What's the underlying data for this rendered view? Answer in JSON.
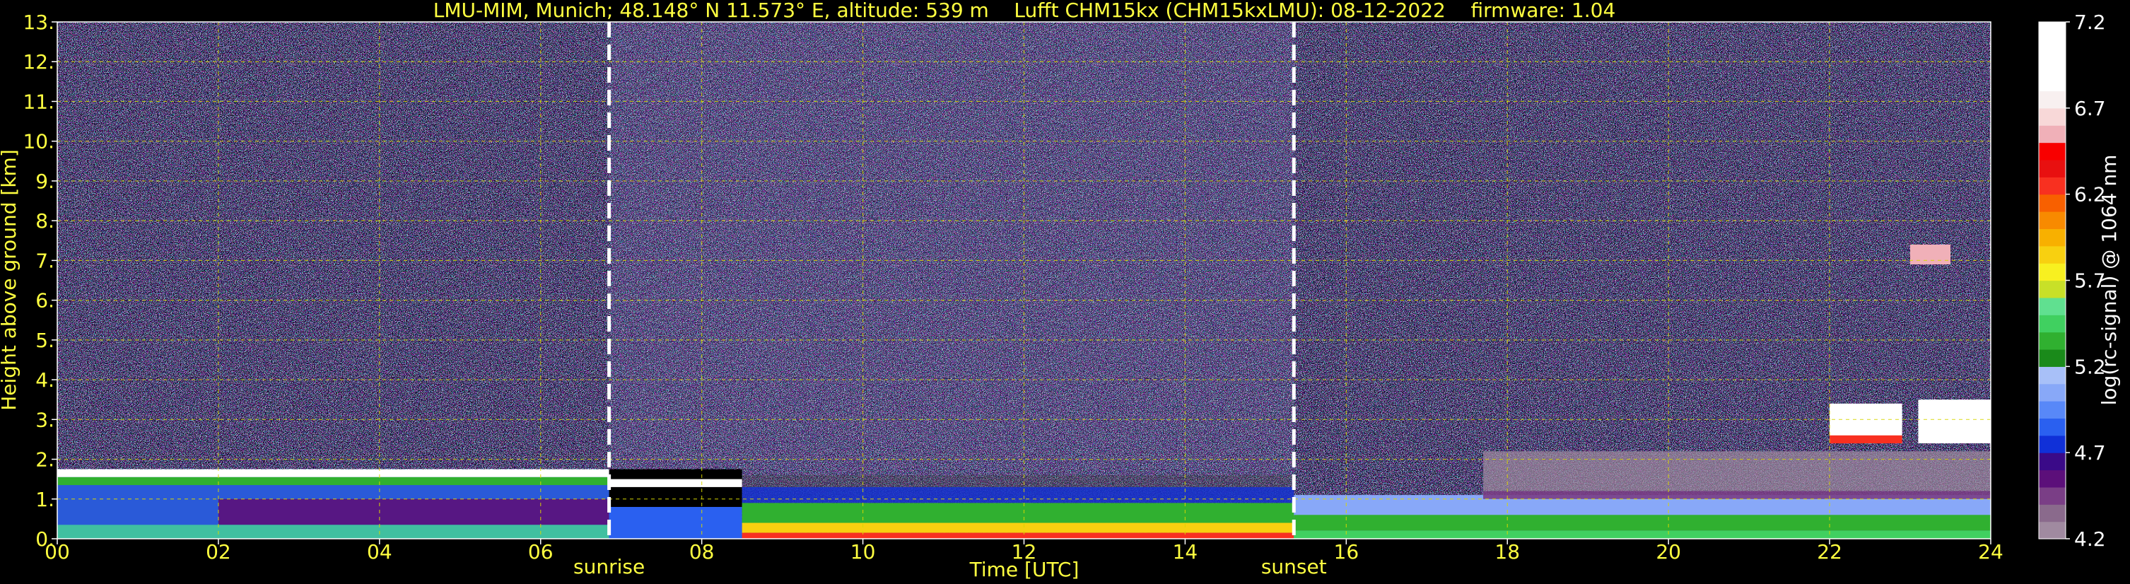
{
  "chart_data": {
    "type": "heatmap",
    "title": "LMU-MIM, Munich; 48.148° N 11.573° E, altitude: 539 m    Lufft CHM15kx (CHM15kxLMU): 08-12-2022    firmware: 1.04",
    "xlabel": "Time [UTC]",
    "ylabel": "Height above ground [km]",
    "xlim": [
      0,
      24
    ],
    "ylim": [
      0,
      13
    ],
    "x_ticks": [
      0,
      2,
      4,
      6,
      8,
      10,
      12,
      14,
      16,
      18,
      20,
      22,
      24
    ],
    "x_tick_labels": [
      "00",
      "02",
      "04",
      "06",
      "08",
      "10",
      "12",
      "14",
      "16",
      "18",
      "20",
      "22",
      "24"
    ],
    "y_ticks": [
      0,
      1,
      2,
      3,
      4,
      5,
      6,
      7,
      8,
      9,
      10,
      11,
      12,
      13
    ],
    "y_tick_labels": [
      "0.",
      "1.",
      "2.",
      "3.",
      "4.",
      "5.",
      "6.",
      "7.",
      "8.",
      "9.",
      "10.",
      "11.",
      "12.",
      "13."
    ],
    "grid": true,
    "annotations": [
      {
        "label": "sunrise",
        "time": 6.85
      },
      {
        "label": "sunset",
        "time": 15.35
      }
    ],
    "colorbar": {
      "label": "log(rc-signal) @ 1064 nm",
      "range": [
        4.2,
        7.2
      ],
      "ticks": [
        4.2,
        4.7,
        5.2,
        5.7,
        6.2,
        6.7,
        7.2
      ],
      "tick_labels": [
        "4.2",
        "4.7",
        "5.2",
        "5.7",
        "6.2",
        "6.7",
        "7.2"
      ],
      "colors": [
        "#a08aa0",
        "#8a6a8c",
        "#7a3e86",
        "#5c0f7a",
        "#3a0a88",
        "#1030d8",
        "#2a60f0",
        "#5888f8",
        "#88a8f8",
        "#a8c0f8",
        "#1a8a1a",
        "#30b030",
        "#40d060",
        "#60e090",
        "#c8e028",
        "#f8f020",
        "#f8d010",
        "#f8b000",
        "#f88a00",
        "#f86000",
        "#f83020",
        "#e81010",
        "#f80000",
        "#f0b0b8",
        "#f8d8d8",
        "#f8f0f0",
        "#ffffff",
        "#ffffff",
        "#ffffff",
        "#ffffff"
      ]
    }
  },
  "colors": {
    "text": "#ffff40",
    "colorbar_text": "#ffffff",
    "grid": "#d8d800",
    "background": "#000000"
  }
}
